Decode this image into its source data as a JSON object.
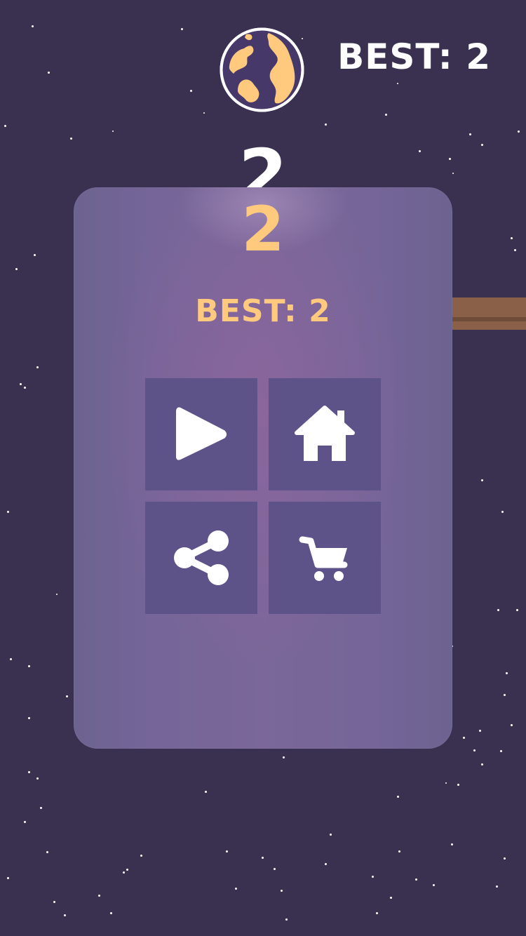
{
  "hud": {
    "best_label": "BEST: 2",
    "score_behind": "2"
  },
  "game_over_panel": {
    "score": "2",
    "best_label": "BEST: 2",
    "buttons": [
      {
        "icon": "play-icon"
      },
      {
        "icon": "home-icon"
      },
      {
        "icon": "share-icon"
      },
      {
        "icon": "cart-icon"
      }
    ]
  },
  "colors": {
    "background": "#3a3150",
    "panel": "#7b6799",
    "button": "#5d5388",
    "accent": "#ffc97e",
    "planet_land": "#ffc97e",
    "planet_sea": "#47386a"
  }
}
